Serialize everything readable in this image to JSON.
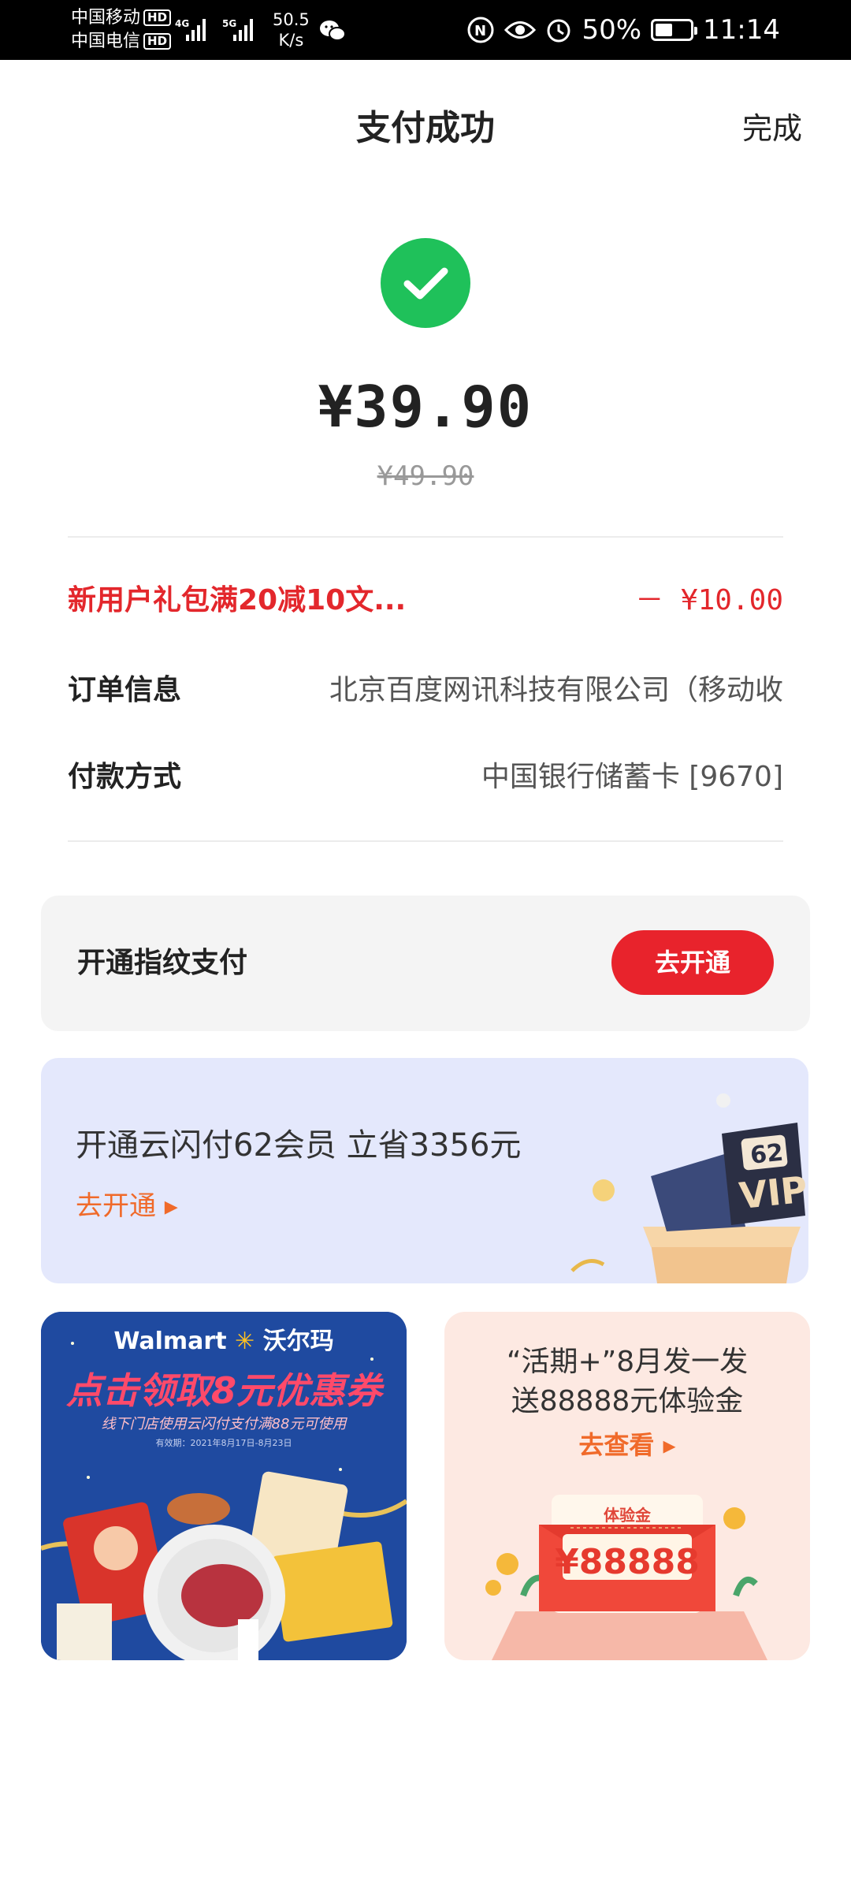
{
  "status_bar": {
    "carrier1": "中国移动",
    "carrier2": "中国电信",
    "hd": "HD",
    "net1": "4G",
    "net2": "5G",
    "speed_value": "50.5",
    "speed_unit": "K/s",
    "battery": "50%",
    "battery_level": 0.5,
    "time": "11:14"
  },
  "header": {
    "title": "支付成功",
    "done_label": "完成"
  },
  "payment": {
    "amount": "¥39.90",
    "original_amount": "¥49.90"
  },
  "details": {
    "promo_label": "新用户礼包满20减10文...",
    "promo_value": "－ ¥10.00",
    "order_label": "订单信息",
    "order_value": "北京百度网讯科技有限公司（移动收",
    "method_label": "付款方式",
    "method_value": "中国银行储蓄卡 [9670]"
  },
  "fingerprint": {
    "title": "开通指纹支付",
    "button": "去开通"
  },
  "vip_banner": {
    "title": "开通云闪付62会员 立省3356元",
    "cta": "去开通 ▸",
    "badge_number": "62",
    "badge_text": "VIP"
  },
  "walmart_tile": {
    "brand_en": "Walmart",
    "brand_cn": "沃尔玛",
    "headline": "点击领取8元优惠券",
    "sub": "线下门店使用云闪付支付满88元可使用",
    "tiny": "有效期：2021年8月17日-8月23日"
  },
  "huoqi_tile": {
    "line1": "“活期+”8月发一发",
    "line2": "送88888元体验金",
    "cta": "去查看 ▸",
    "envelope_label": "体验金",
    "envelope_amount": "¥88888"
  },
  "colors": {
    "success_green": "#1fc15a",
    "accent_red": "#e8232c",
    "cta_orange": "#f06a2a"
  }
}
